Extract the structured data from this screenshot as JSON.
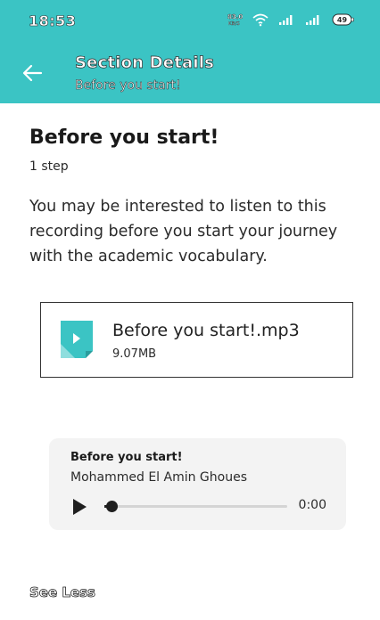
{
  "status_bar": {
    "time": "18:53",
    "battery": "49",
    "icons": [
      "data-speed-icon",
      "wifi-icon",
      "signal-icon",
      "signal-icon",
      "battery-icon"
    ]
  },
  "header": {
    "title": "Section Details",
    "subtitle": "Before you start!",
    "background_color": "#3bc4c4",
    "back_icon": "arrow-left-icon"
  },
  "section": {
    "title": "Before you start!",
    "steps": "1 step",
    "description": "You may be interested to listen to this recording before you start your journey with the academic vocabulary."
  },
  "file": {
    "name": "Before you start!.mp3",
    "size": "9.07MB",
    "icon": "audio-file-icon",
    "icon_color": "#3bc4c4"
  },
  "audio_player": {
    "title": "Before you start!",
    "artist": "Mohammed El Amin Ghoues",
    "time": "0:00",
    "progress": 0.04,
    "play_icon": "play-icon"
  },
  "footer": {
    "see_less_label": "See Less"
  }
}
